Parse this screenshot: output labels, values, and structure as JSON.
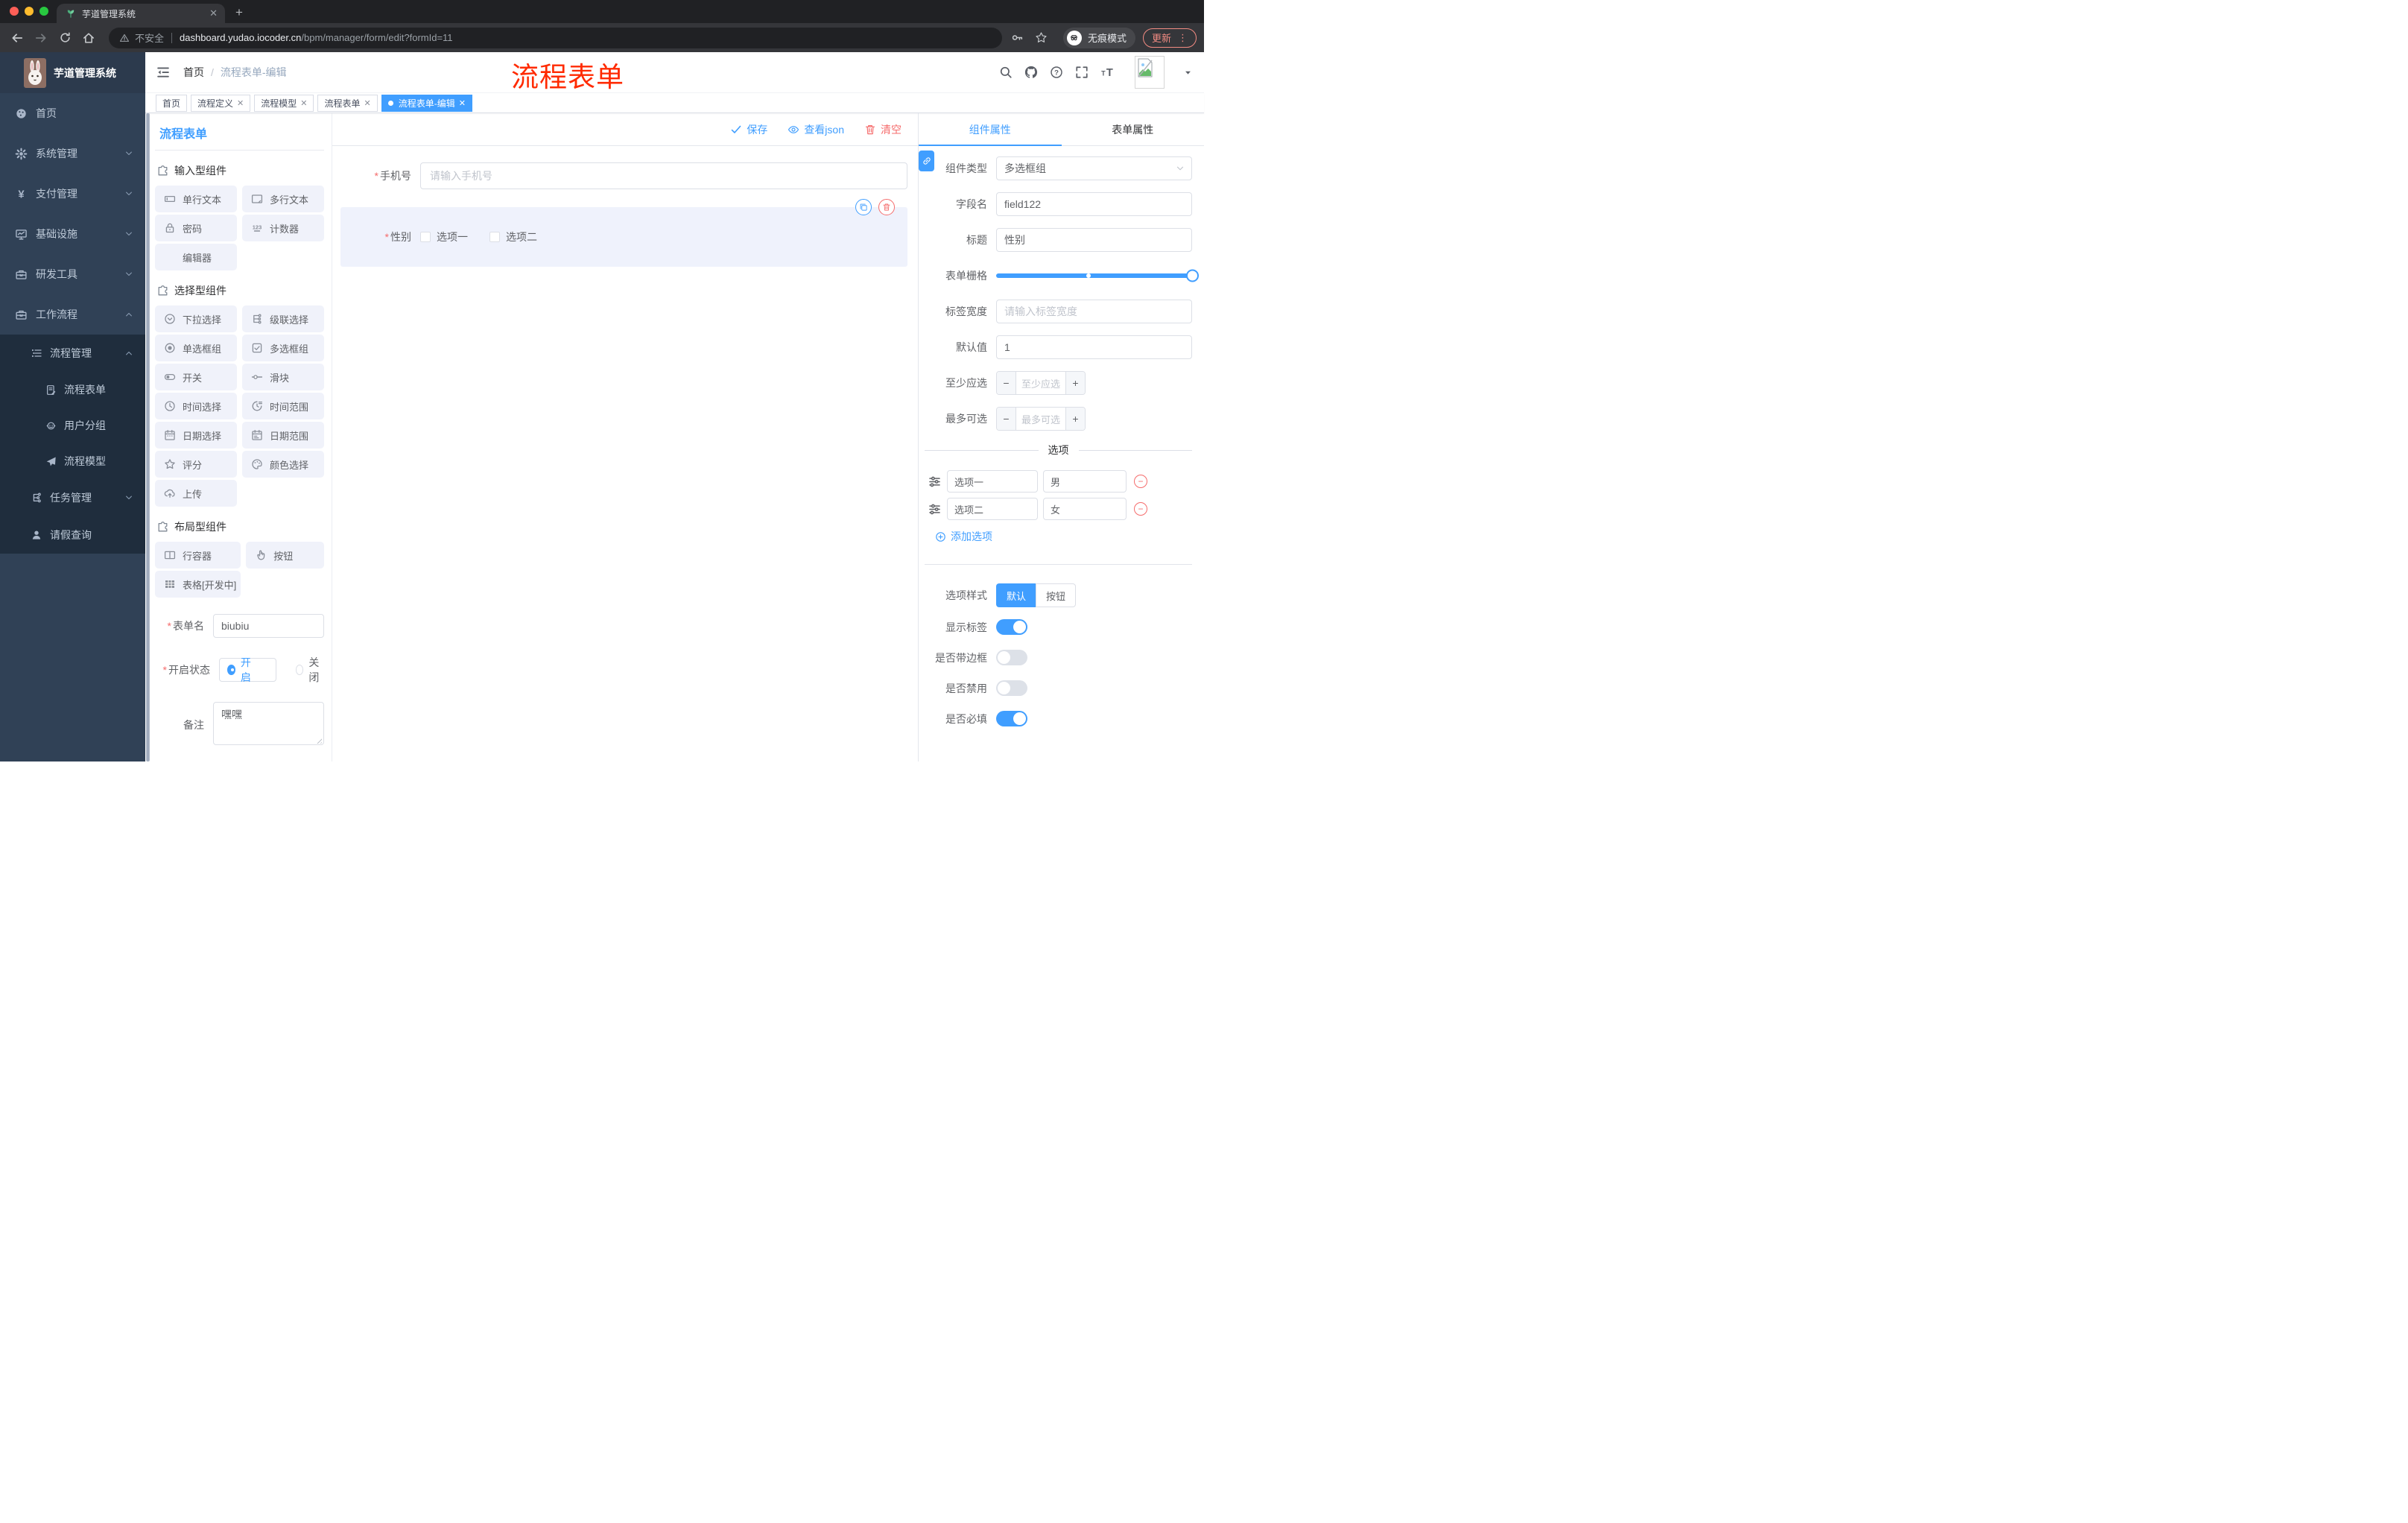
{
  "browser": {
    "tab_title": "芋道管理系统",
    "security_label": "不安全",
    "url_host": "dashboard.yudao.iocoder.cn",
    "url_path": "/bpm/manager/form/edit?formId=11",
    "incognito_label": "无痕模式",
    "update_label": "更新"
  },
  "sidebar": {
    "app_title": "芋道管理系统",
    "menu": [
      {
        "label": "首页",
        "icon": "dashboard"
      },
      {
        "label": "系统管理",
        "icon": "gear",
        "chevron": "down"
      },
      {
        "label": "支付管理",
        "icon": "yen",
        "chevron": "down"
      },
      {
        "label": "基础设施",
        "icon": "monitor",
        "chevron": "down"
      },
      {
        "label": "研发工具",
        "icon": "toolbox",
        "chevron": "down"
      },
      {
        "label": "工作流程",
        "icon": "toolbox",
        "chevron": "up",
        "children": [
          {
            "label": "流程管理",
            "icon": "list-tree",
            "chevron": "up",
            "children": [
              {
                "label": "流程表单",
                "icon": "form-doc"
              },
              {
                "label": "用户分组",
                "icon": "user-group"
              },
              {
                "label": "流程模型",
                "icon": "paper-plane"
              }
            ]
          },
          {
            "label": "任务管理",
            "icon": "task-tree",
            "chevron": "down"
          },
          {
            "label": "请假查询",
            "icon": "person"
          }
        ]
      }
    ]
  },
  "header": {
    "breadcrumb": [
      "首页",
      "流程表单-编辑"
    ],
    "annotation": "流程表单"
  },
  "tags": {
    "items": [
      {
        "label": "首页",
        "closable": false,
        "active": false
      },
      {
        "label": "流程定义",
        "closable": true,
        "active": false
      },
      {
        "label": "流程模型",
        "closable": true,
        "active": false
      },
      {
        "label": "流程表单",
        "closable": true,
        "active": false
      },
      {
        "label": "流程表单-编辑",
        "closable": true,
        "active": true
      }
    ]
  },
  "palette": {
    "title": "流程表单",
    "sections": [
      {
        "title": "输入型组件",
        "items": [
          {
            "label": "单行文本",
            "icon": "input"
          },
          {
            "label": "多行文本",
            "icon": "textarea"
          },
          {
            "label": "密码",
            "icon": "lock"
          },
          {
            "label": "计数器",
            "icon": "counter"
          },
          {
            "label": "编辑器",
            "icon": ""
          }
        ]
      },
      {
        "title": "选择型组件",
        "items": [
          {
            "label": "下拉选择",
            "icon": "select"
          },
          {
            "label": "级联选择",
            "icon": "cascader"
          },
          {
            "label": "单选框组",
            "icon": "radio"
          },
          {
            "label": "多选框组",
            "icon": "checkbox"
          },
          {
            "label": "开关",
            "icon": "switch"
          },
          {
            "label": "滑块",
            "icon": "slider"
          },
          {
            "label": "时间选择",
            "icon": "time"
          },
          {
            "label": "时间范围",
            "icon": "time-range"
          },
          {
            "label": "日期选择",
            "icon": "date"
          },
          {
            "label": "日期范围",
            "icon": "date-range"
          },
          {
            "label": "评分",
            "icon": "star-rate"
          },
          {
            "label": "颜色选择",
            "icon": "color"
          },
          {
            "label": "上传",
            "icon": "upload"
          }
        ]
      },
      {
        "title": "布局型组件",
        "items": [
          {
            "label": "行容器",
            "icon": "row"
          },
          {
            "label": "按钮",
            "icon": "button-hand"
          },
          {
            "label": "表格[开发中]",
            "icon": "table"
          }
        ]
      }
    ]
  },
  "designer_form": {
    "name_label": "表单名",
    "name_value": "biubiu",
    "status_label": "开启状态",
    "status_options": [
      {
        "label": "开启",
        "selected": true
      },
      {
        "label": "关闭",
        "selected": false
      }
    ],
    "remark_label": "备注",
    "remark_value": "嘿嘿"
  },
  "canvas": {
    "toolbar": {
      "save": "保存",
      "view_json": "查看json",
      "clear": "清空"
    },
    "fields": [
      {
        "label": "手机号",
        "required": true,
        "placeholder": "请输入手机号"
      },
      {
        "label": "性别",
        "required": true,
        "options": [
          "选项一",
          "选项二"
        ]
      }
    ]
  },
  "panel": {
    "tabs": [
      "组件属性",
      "表单属性"
    ],
    "active_tab": "组件属性",
    "fields": {
      "component_type": {
        "label": "组件类型",
        "value": "多选框组"
      },
      "field_name": {
        "label": "字段名",
        "value": "field122"
      },
      "title": {
        "label": "标题",
        "value": "性别"
      },
      "grid": {
        "label": "表单栅格"
      },
      "label_width": {
        "label": "标签宽度",
        "placeholder": "请输入标签宽度"
      },
      "default_value": {
        "label": "默认值",
        "value": "1"
      },
      "min_select": {
        "label": "至少应选",
        "placeholder": "至少应选"
      },
      "max_select": {
        "label": "最多可选",
        "placeholder": "最多可选"
      }
    },
    "options_section": {
      "title": "选项",
      "rows": [
        {
          "label": "选项一",
          "value": "男"
        },
        {
          "label": "选项二",
          "value": "女"
        }
      ],
      "add_label": "添加选项"
    },
    "style": {
      "label": "选项样式",
      "options": [
        "默认",
        "按钮"
      ],
      "active": "默认"
    },
    "toggles": [
      {
        "label": "显示标签",
        "on": true
      },
      {
        "label": "是否带边框",
        "on": false
      },
      {
        "label": "是否禁用",
        "on": false
      },
      {
        "label": "是否必填",
        "on": true
      }
    ]
  },
  "colors": {
    "primary": "#409EFF",
    "danger": "#F56C6C",
    "sidebar_bg": "#304156",
    "submenu_bg": "#1F2D3D",
    "annotation_red": "#FF2A00"
  }
}
